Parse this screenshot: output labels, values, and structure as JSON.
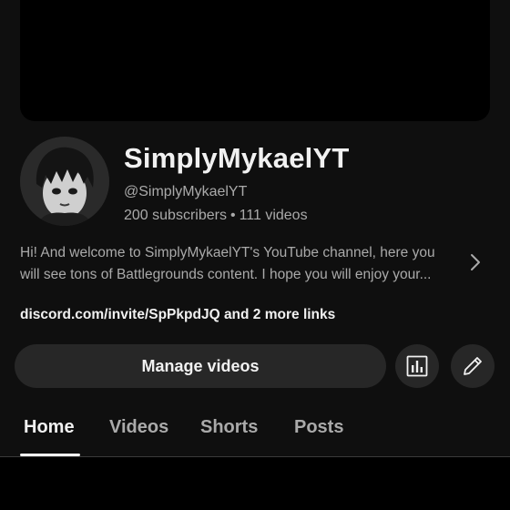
{
  "channel": {
    "name": "SimplyMykaelYT",
    "handle": "@SimplyMykaelYT",
    "subscribers": "200 subscribers",
    "separator": "•",
    "videos": "111 videos",
    "description_line1": "Hi! And welcome to SimplyMykaelYT's YouTube channel, here you",
    "description_line2": "will see tons of Battlegrounds content. I hope you will enjoy your...",
    "links": "discord.com/invite/SpPkpdJQ and 2 more links"
  },
  "actions": {
    "manage_videos_label": "Manage videos",
    "analytics_icon": "analytics-icon",
    "edit_icon": "pencil-icon"
  },
  "tabs": [
    {
      "label": "Home",
      "active": true
    },
    {
      "label": "Videos",
      "active": false
    },
    {
      "label": "Shorts",
      "active": false
    },
    {
      "label": "Posts",
      "active": false
    }
  ],
  "colors": {
    "background": "#0f0f0f",
    "primary_text": "#f1f1f1",
    "secondary_text": "#aaaaaa",
    "button_bg": "#272727",
    "banner": "#000000"
  }
}
